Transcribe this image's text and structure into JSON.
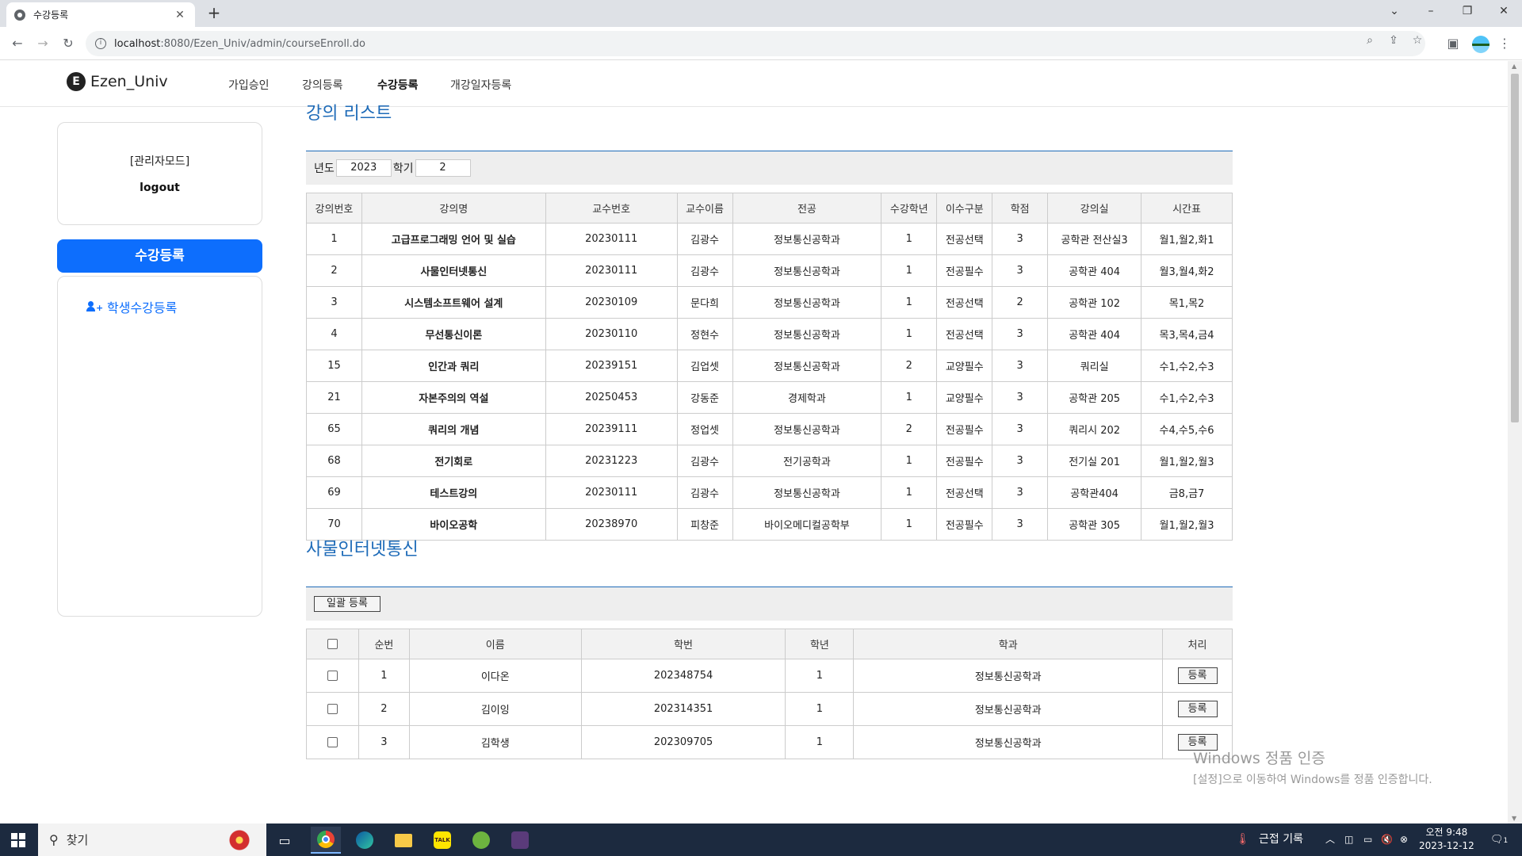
{
  "browser": {
    "tab_title": "수강등록",
    "url_host": "localhost",
    "url_rest": ":8080/Ezen_Univ/admin/courseEnroll.do"
  },
  "header": {
    "brand": "Ezen_Univ",
    "brand_icon": "E",
    "nav": [
      {
        "label": "가입승인",
        "active": false
      },
      {
        "label": "강의등록",
        "active": false
      },
      {
        "label": "수강등록",
        "active": true
      },
      {
        "label": "개강일자등록",
        "active": false
      }
    ]
  },
  "sidebar": {
    "mode": "[관리자모드]",
    "logout": "logout",
    "section_button": "수강등록",
    "link": "학생수강등록"
  },
  "course_section": {
    "title": "강의 리스트",
    "year_label": "년도",
    "year_value": "2023",
    "term_label": "학기",
    "term_value": "2",
    "headers": [
      "강의번호",
      "강의명",
      "교수번호",
      "교수이름",
      "전공",
      "수강학년",
      "이수구분",
      "학점",
      "강의실",
      "시간표"
    ],
    "rows": [
      [
        "1",
        "고급프로그래밍 언어 및 실습",
        "20230111",
        "김광수",
        "정보통신공학과",
        "1",
        "전공선택",
        "3",
        "공학관 전산실3",
        "월1,월2,화1"
      ],
      [
        "2",
        "사물인터넷통신",
        "20230111",
        "김광수",
        "정보통신공학과",
        "1",
        "전공필수",
        "3",
        "공학관 404",
        "월3,월4,화2"
      ],
      [
        "3",
        "시스템소프트웨어 설계",
        "20230109",
        "문다희",
        "정보통신공학과",
        "1",
        "전공선택",
        "2",
        "공학관 102",
        "목1,목2"
      ],
      [
        "4",
        "무선통신이론",
        "20230110",
        "정현수",
        "정보통신공학과",
        "1",
        "전공선택",
        "3",
        "공학관 404",
        "목3,목4,금4"
      ],
      [
        "15",
        "인간과 쿼리",
        "20239151",
        "김업셋",
        "정보통신공학과",
        "2",
        "교양필수",
        "3",
        "쿼리실",
        "수1,수2,수3"
      ],
      [
        "21",
        "자본주의의 역설",
        "20250453",
        "강동준",
        "경제학과",
        "1",
        "교양필수",
        "3",
        "공학관 205",
        "수1,수2,수3"
      ],
      [
        "65",
        "쿼리의 개념",
        "20239111",
        "정업셋",
        "정보통신공학과",
        "2",
        "전공필수",
        "3",
        "쿼리시 202",
        "수4,수5,수6"
      ],
      [
        "68",
        "전기회로",
        "20231223",
        "김광수",
        "전기공학과",
        "1",
        "전공필수",
        "3",
        "전기실 201",
        "월1,월2,월3"
      ],
      [
        "69",
        "테스트강의",
        "20230111",
        "김광수",
        "정보통신공학과",
        "1",
        "전공선택",
        "3",
        "공학관404",
        "금8,금7"
      ],
      [
        "70",
        "바이오공학",
        "20238970",
        "피창준",
        "바이오메디컬공학부",
        "1",
        "전공필수",
        "3",
        "공학관 305",
        "월1,월2,월3"
      ]
    ]
  },
  "student_section": {
    "title": "사물인터넷통신",
    "bulk_button": "일괄 등록",
    "headers": [
      "순번",
      "이름",
      "학번",
      "학년",
      "학과",
      "처리"
    ],
    "register_label": "등록",
    "rows": [
      [
        "1",
        "이다온",
        "202348754",
        "1",
        "정보통신공학과"
      ],
      [
        "2",
        "김이잉",
        "202314351",
        "1",
        "정보통신공학과"
      ],
      [
        "3",
        "김학생",
        "202309705",
        "1",
        "정보통신공학과"
      ]
    ]
  },
  "watermark": {
    "line1": "Windows 정품 인증",
    "line2": "[설정]으로 이동하여 Windows를 정품 인증합니다."
  },
  "taskbar": {
    "search_placeholder": "찾기",
    "weather": "근접 기록",
    "time": "오전 9:48",
    "date": "2023-12-12",
    "notifications": "1"
  }
}
